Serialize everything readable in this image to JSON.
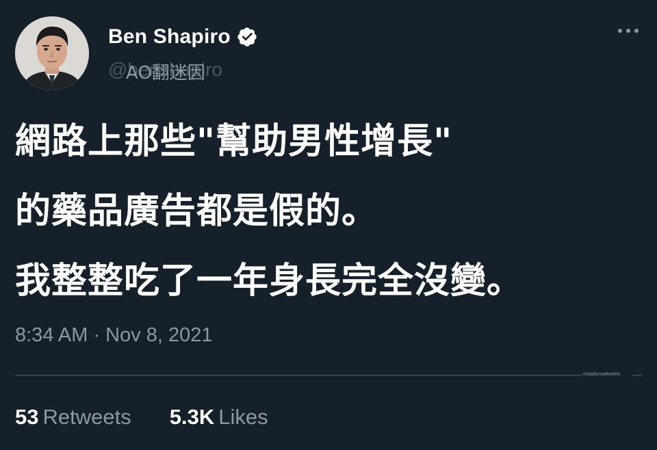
{
  "author": {
    "display_name": "Ben Shapiro",
    "handle": "@benshapiro",
    "handle_overlay": "AO翻迷因",
    "verified": true,
    "verified_icon": "verified-badge-icon",
    "avatar_icon": "profile-avatar"
  },
  "menu": {
    "icon": "more-horizontal-icon"
  },
  "tweet": {
    "lines": [
      "網路上那些\"幫助男性增長\"",
      "的藥品廣告都是假的。",
      "我整整吃了一年身長完全沒變。"
    ],
    "timestamp": "8:34 AM · Nov 8, 2021"
  },
  "watermark": "r/totallyrealtweets",
  "stats": {
    "retweets_count": "53",
    "retweets_label": "Retweets",
    "likes_count": "5.3K",
    "likes_label": "Likes"
  },
  "colors": {
    "background": "#15202b",
    "text_primary": "#ffffff",
    "text_secondary": "#8b98a5",
    "divider": "#38444d",
    "verified_badge": "#ffffff"
  }
}
